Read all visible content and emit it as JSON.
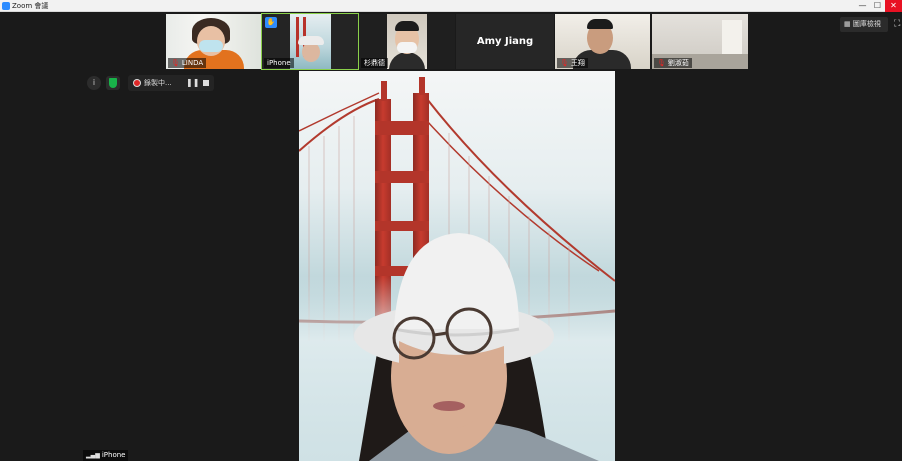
{
  "window": {
    "title": "Zoom 會議",
    "minimize": "—",
    "maximize": "☐",
    "close": "✕"
  },
  "gallery": {
    "participants": [
      {
        "name": "LINDA",
        "muted": true,
        "video": true
      },
      {
        "name": "iPhone",
        "muted": false,
        "video": true,
        "hand_raised": true,
        "active_speaker": true
      },
      {
        "name": "杉鼎德",
        "muted": false,
        "video": true
      },
      {
        "name": "Amy Jiang",
        "muted": false,
        "video": false
      },
      {
        "name": "王翔",
        "muted": true,
        "video": true
      },
      {
        "name": "劉淑茹",
        "muted": true,
        "video": true
      }
    ],
    "view_button_label": "圖庫檢視",
    "fullscreen_icon": "⛶"
  },
  "status": {
    "info_icon": "i",
    "recording_label": "錄製中...",
    "pause_icon": "❚❚"
  },
  "speaker": {
    "name": "iPhone",
    "signal_icon": "▂▄▆"
  },
  "colors": {
    "background": "#1a1a1a",
    "active_border": "#8ad04a",
    "encryption_green": "#19b34a",
    "recording_red": "#e02828",
    "raise_hand_blue": "#2d8cff",
    "bridge_red": "#c0392b"
  }
}
